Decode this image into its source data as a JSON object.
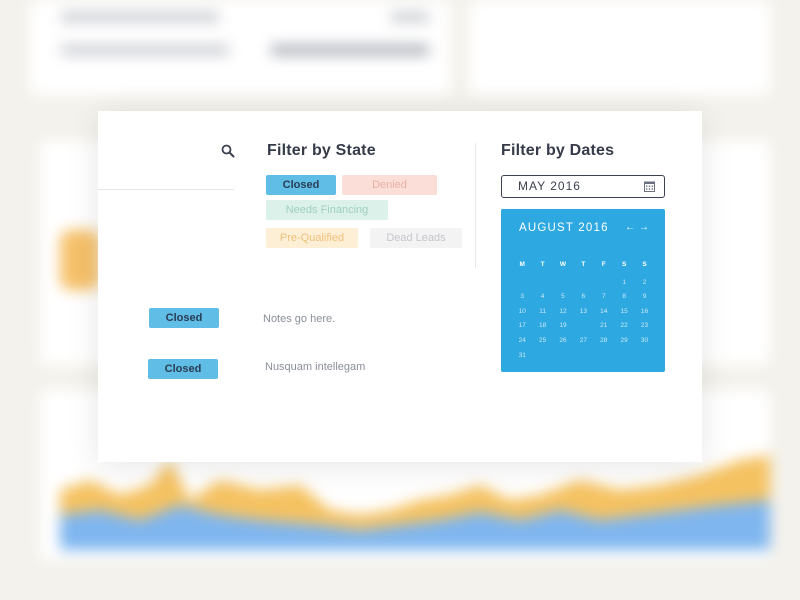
{
  "filter_state": {
    "title": "Filter by State",
    "states": [
      {
        "label": "Closed",
        "bg": "#5fbde6",
        "fg": "#2a3d55"
      },
      {
        "label": "Denied",
        "bg": "#fbded7",
        "fg": "#e7b0a4"
      },
      {
        "label": "Needs Financing",
        "bg": "#dcf1ea",
        "fg": "#9fcfbf"
      },
      {
        "label": "Pre-Qualified",
        "bg": "#fdefd6",
        "fg": "#efc07b"
      },
      {
        "label": "Dead Leads",
        "bg": "#f3f3f4",
        "fg": "#c4c6cb"
      }
    ]
  },
  "rows": [
    {
      "badge": "Closed",
      "note": "Notes go here."
    },
    {
      "badge": "Closed",
      "note": "Nusquam intellegam"
    }
  ],
  "filter_dates": {
    "title": "Filter by Dates",
    "input_value": "MAY 2016",
    "calendar": {
      "month_label": "AUGUST 2016",
      "prev_label": "←",
      "next_label": "→",
      "weekdays": [
        "M",
        "T",
        "W",
        "T",
        "F",
        "S",
        "S"
      ],
      "weeks": [
        [
          "",
          "",
          "",
          "",
          "",
          "1",
          "2"
        ],
        [
          "3",
          "4",
          "5",
          "6",
          "7",
          "8",
          "9"
        ],
        [
          "10",
          "11",
          "12",
          "13",
          "14",
          "15",
          "16"
        ],
        [
          "17",
          "18",
          "19",
          "20",
          "21",
          "22",
          "23"
        ],
        [
          "24",
          "25",
          "26",
          "27",
          "28",
          "29",
          "30"
        ],
        [
          "31",
          "",
          "",
          "",
          "",
          "",
          ""
        ]
      ],
      "selected_day": "20",
      "accent_color": "#2ea8e0"
    }
  }
}
